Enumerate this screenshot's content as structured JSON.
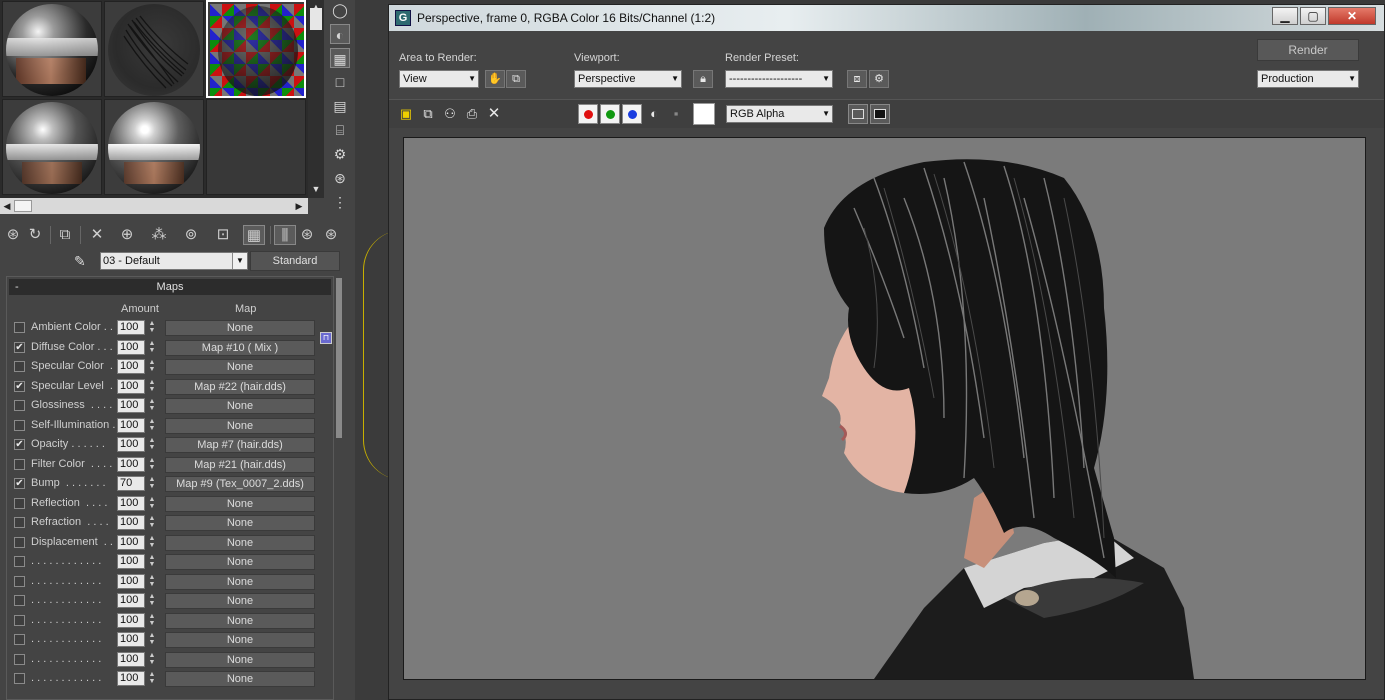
{
  "material_editor": {
    "slots": [
      "hair-material-sphere-1",
      "hair-texture-swatch",
      "checker-map-sphere",
      "hair-material-sphere-2",
      "hair-material-sphere-3",
      "empty-slot"
    ],
    "material_name": "03 - Default",
    "material_type": "Standard",
    "maps_rollout": {
      "title": "Maps",
      "collapse_symbol": "-",
      "col_amount": "Amount",
      "col_map": "Map",
      "rows": [
        {
          "label": "Ambient Color . .",
          "checked": false,
          "amount": "100",
          "map": "None"
        },
        {
          "label": "Diffuse Color . . .",
          "checked": true,
          "amount": "100",
          "map": "Map #10  ( Mix )"
        },
        {
          "label": "Specular Color  .",
          "checked": false,
          "amount": "100",
          "map": "None"
        },
        {
          "label": "Specular Level  .",
          "checked": true,
          "amount": "100",
          "map": "Map #22 (hair.dds)"
        },
        {
          "label": "Glossiness  . . . .",
          "checked": false,
          "amount": "100",
          "map": "None"
        },
        {
          "label": "Self-Illumination .",
          "checked": false,
          "amount": "100",
          "map": "None"
        },
        {
          "label": "Opacity . . . . . .",
          "checked": true,
          "amount": "100",
          "map": "Map #7 (hair.dds)"
        },
        {
          "label": "Filter Color  . . . .",
          "checked": false,
          "amount": "100",
          "map": "Map #21 (hair.dds)"
        },
        {
          "label": "Bump  . . . . . . .",
          "checked": true,
          "amount": "70",
          "map": "Map #9 (Tex_0007_2.dds)"
        },
        {
          "label": "Reflection  . . . .",
          "checked": false,
          "amount": "100",
          "map": "None"
        },
        {
          "label": "Refraction  . . . .",
          "checked": false,
          "amount": "100",
          "map": "None"
        },
        {
          "label": "Displacement  . .",
          "checked": false,
          "amount": "100",
          "map": "None"
        },
        {
          "label": ". . . . . . . . . . . .",
          "checked": false,
          "amount": "100",
          "map": "None"
        },
        {
          "label": ". . . . . . . . . . . .",
          "checked": false,
          "amount": "100",
          "map": "None"
        },
        {
          "label": ". . . . . . . . . . . .",
          "checked": false,
          "amount": "100",
          "map": "None"
        },
        {
          "label": ". . . . . . . . . . . .",
          "checked": false,
          "amount": "100",
          "map": "None"
        },
        {
          "label": ". . . . . . . . . . . .",
          "checked": false,
          "amount": "100",
          "map": "None"
        },
        {
          "label": ". . . . . . . . . . . .",
          "checked": false,
          "amount": "100",
          "map": "None"
        },
        {
          "label": ". . . . . . . . . . . .",
          "checked": false,
          "amount": "100",
          "map": "None"
        }
      ]
    },
    "toolbar_icons": [
      "get-material-icon",
      "put-to-scene-icon",
      "assign-to-selection-icon",
      "reset-map-icon",
      "copy-material-icon",
      "make-unique-icon",
      "put-to-library-icon",
      "material-id-icon",
      "show-map-in-viewport-icon",
      "show-end-result-icon",
      "go-to-parent-icon",
      "go-forward-to-sibling-icon"
    ],
    "side_icons": [
      "sample-type-icon",
      "backlight-icon",
      "background-checker-icon",
      "sample-uv-tiling-icon",
      "video-color-check-icon",
      "make-preview-icon",
      "options-icon",
      "select-by-material-icon",
      "material-map-navigator-icon"
    ]
  },
  "render_window": {
    "title": "Perspective, frame 0, RGBA Color 16 Bits/Channel (1:2)",
    "app_icon_letter": "G",
    "area_to_render_label": "Area to Render:",
    "area_to_render_value": "View",
    "viewport_label": "Viewport:",
    "viewport_value": "Perspective",
    "render_preset_label": "Render Preset:",
    "render_preset_value": "--------------------",
    "render_button": "Render",
    "production_value": "Production",
    "channel_display_value": "RGB Alpha",
    "channel_colors": {
      "red": "#e01010",
      "green": "#119911",
      "blue": "#1a3de0"
    },
    "toolbar_icons": [
      "save-image-icon",
      "copy-image-icon",
      "clone-frame-window-icon",
      "print-image-icon",
      "clear-icon"
    ]
  }
}
